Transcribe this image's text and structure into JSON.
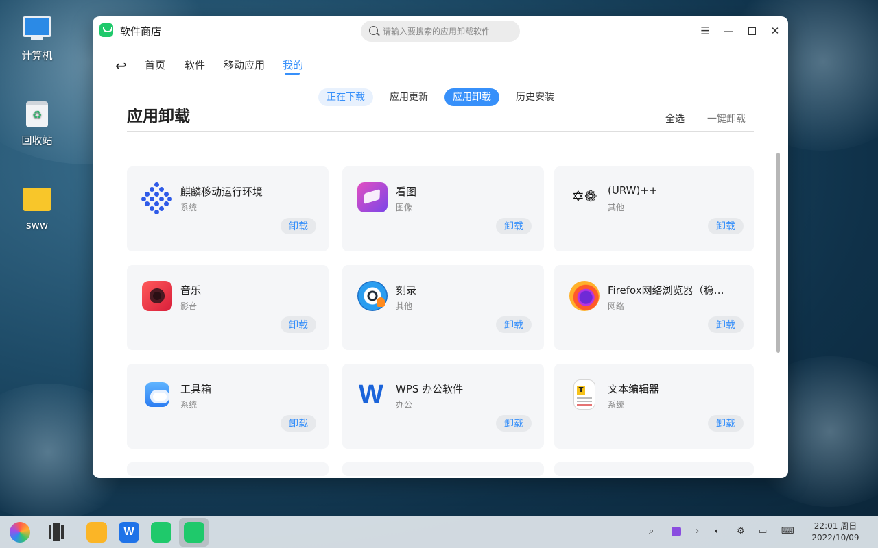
{
  "desktop": {
    "icons": [
      {
        "label": "计算机"
      },
      {
        "label": "回收站"
      },
      {
        "label": "sww"
      }
    ]
  },
  "window": {
    "title": "软件商店",
    "search_placeholder": "请输入要搜索的应用卸载软件",
    "nav": [
      "首页",
      "软件",
      "移动应用",
      "我的"
    ],
    "subtabs": [
      "正在下载",
      "应用更新",
      "应用卸载",
      "历史安装"
    ],
    "page_title": "应用卸载",
    "select_all": "全选",
    "one_key_uninstall": "一键卸载",
    "uninstall_label": "卸载",
    "apps": [
      {
        "name": "麒麟移动运行环境",
        "category": "系统",
        "icon": "kylin-icon"
      },
      {
        "name": "看图",
        "category": "图像",
        "icon": "image-viewer-icon"
      },
      {
        "name": "(URW)++",
        "category": "其他",
        "icon": "urw-icon"
      },
      {
        "name": "音乐",
        "category": "影音",
        "icon": "music-icon"
      },
      {
        "name": "刻录",
        "category": "其他",
        "icon": "burner-icon"
      },
      {
        "name": "Firefox网络浏览器（稳…",
        "category": "网络",
        "icon": "firefox-icon"
      },
      {
        "name": "工具箱",
        "category": "系统",
        "icon": "toolbox-icon"
      },
      {
        "name": "WPS 办公软件",
        "category": "办公",
        "icon": "wps-icon"
      },
      {
        "name": "文本编辑器",
        "category": "系统",
        "icon": "text-editor-icon"
      }
    ]
  },
  "taskbar": {
    "time": "22:01 周日",
    "date": "2022/10/09"
  }
}
